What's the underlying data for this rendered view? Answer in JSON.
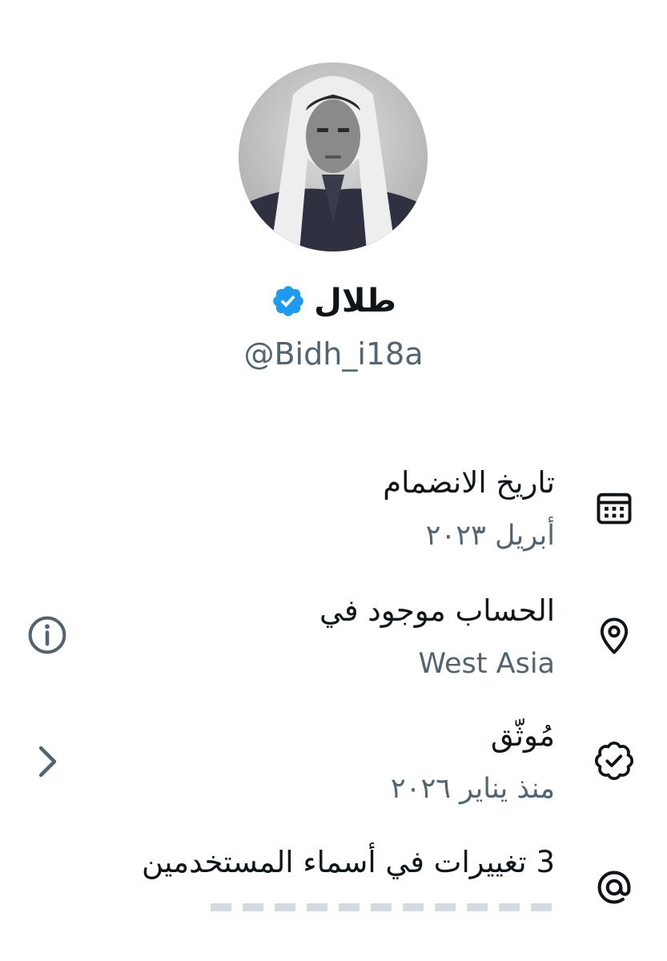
{
  "profile": {
    "display_name": "طلال",
    "handle": "@Bidh_i18a",
    "avatar_icon": "profile-photo",
    "verified_badge_color": "#1d9bf0"
  },
  "info": {
    "joined": {
      "icon": "calendar-icon",
      "title": "تاريخ الانضمام",
      "value": "أبريل ٢٠٢٣"
    },
    "location": {
      "icon": "location-pin-icon",
      "title": "الحساب موجود في",
      "value": "West Asia",
      "side_icon": "info-icon"
    },
    "verified": {
      "icon": "verified-badge-icon",
      "title": "مُوثّق",
      "value": "منذ يناير ٢٠٢٦",
      "side_icon": "chevron-right-icon"
    },
    "username_changes": {
      "icon": "at-sign-icon",
      "title": "3 تغييرات في أسماء المستخدمين"
    }
  },
  "colors": {
    "text_primary": "#0f1419",
    "text_secondary": "#536471",
    "background": "#ffffff"
  }
}
